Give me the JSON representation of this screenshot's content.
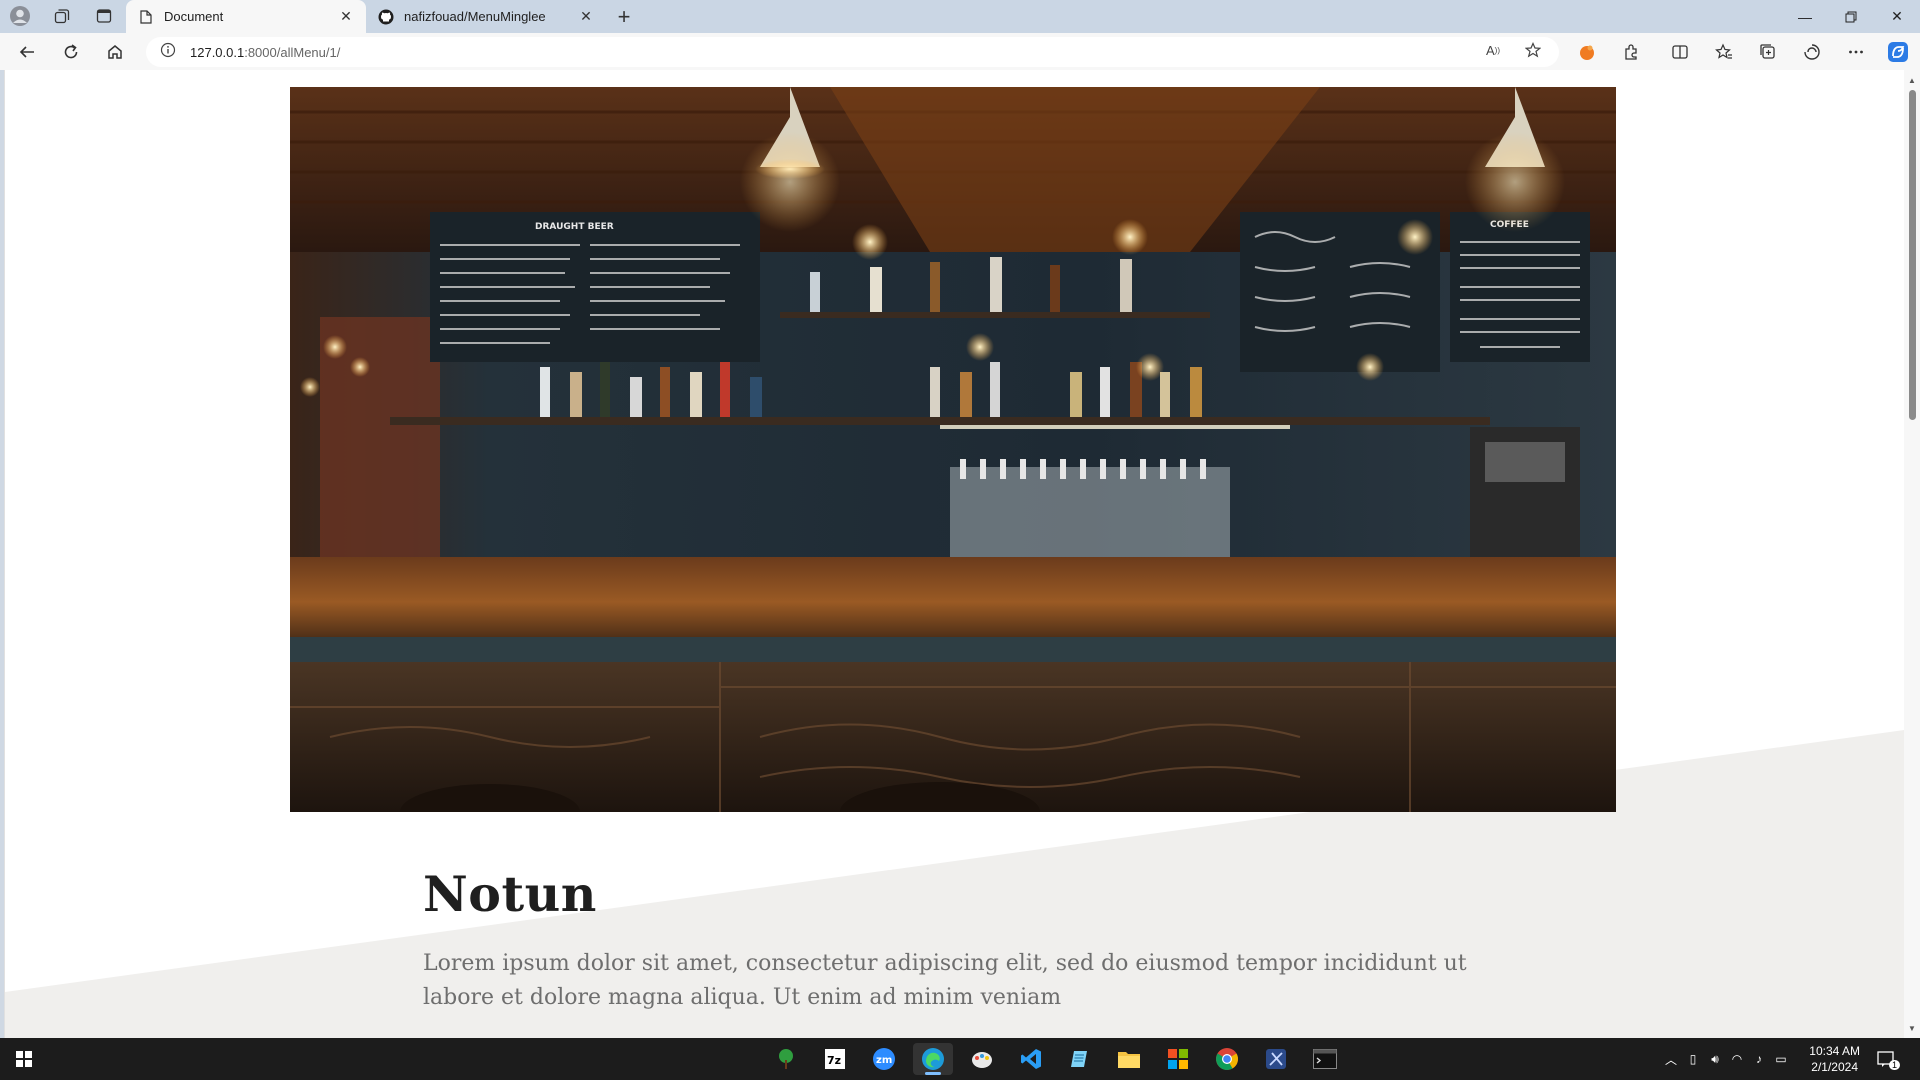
{
  "browser": {
    "tabs": [
      {
        "title": "Document",
        "active": true
      },
      {
        "title": "nafizfouad/MenuMinglee",
        "active": false
      }
    ],
    "url_host": "127.0.0.1",
    "url_path": ":8000/allMenu/1/"
  },
  "page": {
    "title": "Notun",
    "description": "Lorem ipsum dolor sit amet, consectetur adipiscing elit, sed do eiusmod tempor incididunt ut labore et dolore magna aliqua. Ut enim ad minim veniam",
    "hero_image": "cafe bar counter photo",
    "chalkboard_heading": "DRAUGHT BEER",
    "chalkboard_coffee": "COFFEE"
  },
  "taskbar": {
    "time": "10:34 AM",
    "date": "2/1/2024",
    "notification_count": "1"
  },
  "colors": {
    "accent": "#2f6fd1",
    "slant": "#f0efed"
  }
}
